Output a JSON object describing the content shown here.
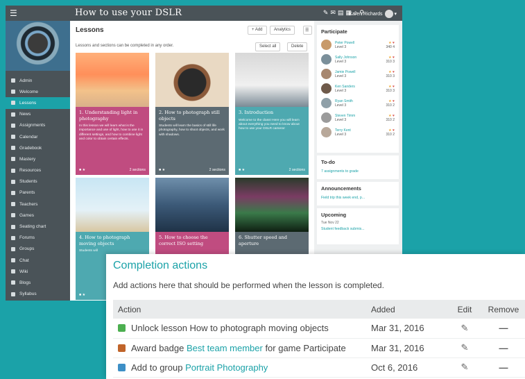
{
  "topbar": {
    "menu_icon": "hamburger-icon",
    "title": "How to use your DSLR",
    "user": "Karen Richards"
  },
  "sidebar": {
    "items": [
      {
        "label": "Admin"
      },
      {
        "label": "Welcome"
      },
      {
        "label": "Lessons",
        "active": true
      },
      {
        "label": "News"
      },
      {
        "label": "Assignments"
      },
      {
        "label": "Calendar"
      },
      {
        "label": "Gradebook"
      },
      {
        "label": "Mastery"
      },
      {
        "label": "Resources"
      },
      {
        "label": "Students"
      },
      {
        "label": "Parents"
      },
      {
        "label": "Teachers"
      },
      {
        "label": "Games"
      },
      {
        "label": "Seating chart"
      },
      {
        "label": "Forums"
      },
      {
        "label": "Groups"
      },
      {
        "label": "Chat"
      },
      {
        "label": "Wiki"
      },
      {
        "label": "Blogs"
      },
      {
        "label": "Syllabus"
      }
    ]
  },
  "main": {
    "title": "Lessons",
    "subtitle": "Lessons and sections can be completed in any order.",
    "add_label": "+ Add",
    "analytics_label": "Analytics",
    "select_all_label": "Select all",
    "delete_label": "Delete",
    "cards": [
      {
        "title": "1. Understanding light in photography",
        "desc": "In this lesson we will learn what is the importance and use of light, how to use it in different settings, and how to combine light and color to obtain certain effects.",
        "sections": "2 sections",
        "color": "#c04c80"
      },
      {
        "title": "2. How to photograph still objects",
        "desc": "Students will learn the basics of still life photography, how to shoot objects, and work with shadows.",
        "sections": "2 sections",
        "color": "#5c6a72"
      },
      {
        "title": "3. Introduction",
        "desc": "Welcome to the class! Here you will learn about everything you need to know about how to use your DSLR camera!",
        "sections": "2 sections",
        "color": "#4ea9b0"
      },
      {
        "title": "4. How to photograph moving objects",
        "desc": "Students will",
        "sections": "",
        "color": "#4ea9b0"
      },
      {
        "title": "5. How to choose the correct ISO setting",
        "desc": "",
        "sections": "",
        "color": "#c04c80"
      },
      {
        "title": "6. Shutter speed and aperture",
        "desc": "",
        "sections": "",
        "color": "#5c6a72"
      }
    ]
  },
  "right": {
    "participate": {
      "title": "Participate",
      "rows": [
        {
          "name": "Peter Powell",
          "level": "Level 3",
          "score": "340",
          "badges": "4"
        },
        {
          "name": "Sally Johnson",
          "level": "Level 3",
          "score": "310",
          "badges": "3"
        },
        {
          "name": "Jamie Powell",
          "level": "Level 3",
          "score": "310",
          "badges": "3"
        },
        {
          "name": "Ken Sanders",
          "level": "Level 3",
          "score": "310",
          "badges": "3"
        },
        {
          "name": "Ryan Smith",
          "level": "Level 3",
          "score": "310",
          "badges": "2"
        },
        {
          "name": "Steven Timm",
          "level": "Level 3",
          "score": "310",
          "badges": "2"
        },
        {
          "name": "Terry Kent",
          "level": "Level 3",
          "score": "310",
          "badges": "2"
        }
      ]
    },
    "todo": {
      "title": "To-do",
      "item": "7 assignments to grade"
    },
    "announcements": {
      "title": "Announcements",
      "item": "Field trip this week end, p..."
    },
    "upcoming": {
      "title": "Upcoming",
      "date": "Tue Nov 22",
      "item": "Student feedback submis..."
    }
  },
  "completion": {
    "title": "Completion actions",
    "description": "Add actions here that should be performed when the lesson is completed.",
    "headers": {
      "action": "Action",
      "added": "Added",
      "edit": "Edit",
      "remove": "Remove"
    },
    "rows": [
      {
        "icon": "lock-icon",
        "icon_color": "#4caf50",
        "prefix": "Unlock lesson How to photograph moving objects",
        "link": "",
        "suffix": "",
        "added": "Mar 31, 2016"
      },
      {
        "icon": "badge-icon",
        "icon_color": "#c0642a",
        "prefix": "Award badge ",
        "link": "Best team member",
        "suffix": " for game Participate",
        "added": "Mar 31, 2016"
      },
      {
        "icon": "group-icon",
        "icon_color": "#3d8fc6",
        "prefix": "Add to group ",
        "link": "Portrait Photography",
        "suffix": "",
        "added": "Oct 6, 2016"
      }
    ]
  }
}
